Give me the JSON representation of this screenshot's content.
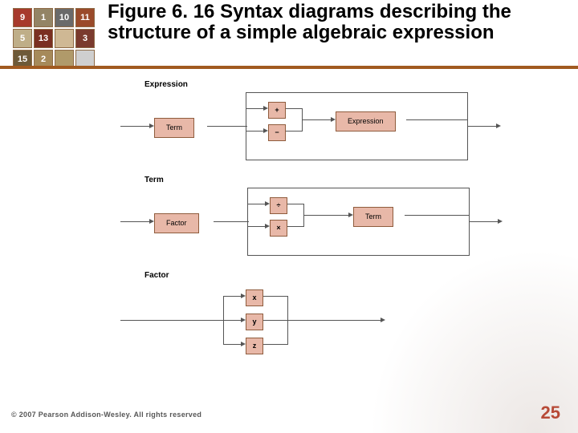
{
  "title": {
    "lead": "Figure 6. 16",
    "rest": "Syntax diagrams describing the structure of a simple algebraic expression"
  },
  "puzzle": {
    "cells": [
      {
        "n": "9",
        "bg": "#a73a2c"
      },
      {
        "n": "1",
        "bg": "#938465"
      },
      {
        "n": "10",
        "bg": "#6a6a6a"
      },
      {
        "n": "11",
        "bg": "#9a4a2a"
      },
      {
        "n": "5",
        "bg": "#bfae88"
      },
      {
        "n": "13",
        "bg": "#7a2f22"
      },
      {
        "n": "",
        "bg": "#cfb894"
      },
      {
        "n": "3",
        "bg": "#7a3a2e"
      },
      {
        "n": "15",
        "bg": "#6e5a38"
      },
      {
        "n": "2",
        "bg": "#a68a5a"
      },
      {
        "n": "",
        "bg": "#b09a6a"
      },
      {
        "n": "",
        "bg": "#cfcfcf"
      }
    ]
  },
  "diagrams": {
    "expression": {
      "title": "Expression",
      "term_box": "Term",
      "op1": "+",
      "op2": "−",
      "recurse_box": "Expression"
    },
    "term": {
      "title": "Term",
      "factor_box": "Factor",
      "op1": "÷",
      "op2": "×",
      "recurse_box": "Term"
    },
    "factor": {
      "title": "Factor",
      "sym1": "x",
      "sym2": "y",
      "sym3": "z"
    }
  },
  "footer": "© 2007 Pearson Addison-Wesley. All rights reserved",
  "page_number": "25"
}
